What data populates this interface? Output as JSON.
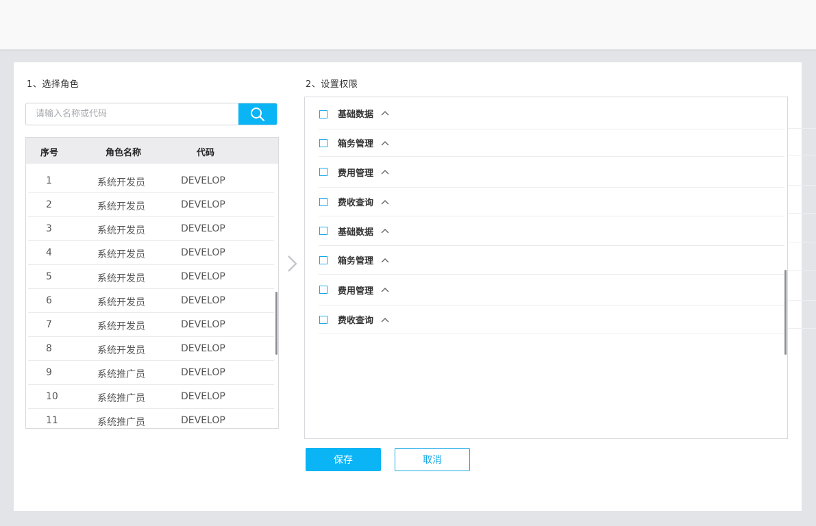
{
  "left": {
    "title": "1、选择角色",
    "search_placeholder": "请输入名称或代码",
    "table": {
      "headers": [
        "序号",
        "角色名称",
        "代码"
      ],
      "rows": [
        {
          "no": "1",
          "name": "系统开发员",
          "code": "DEVELOP"
        },
        {
          "no": "2",
          "name": "系统开发员",
          "code": "DEVELOP"
        },
        {
          "no": "3",
          "name": "系统开发员",
          "code": "DEVELOP"
        },
        {
          "no": "4",
          "name": "系统开发员",
          "code": "DEVELOP"
        },
        {
          "no": "5",
          "name": "系统开发员",
          "code": "DEVELOP"
        },
        {
          "no": "6",
          "name": "系统开发员",
          "code": "DEVELOP"
        },
        {
          "no": "7",
          "name": "系统开发员",
          "code": "DEVELOP"
        },
        {
          "no": "8",
          "name": "系统开发员",
          "code": "DEVELOP"
        },
        {
          "no": "9",
          "name": "系统推广员",
          "code": "DEVELOP"
        },
        {
          "no": "10",
          "name": "系统推广员",
          "code": "DEVELOP"
        },
        {
          "no": "11",
          "name": "系统推广员",
          "code": "DEVELOP"
        }
      ]
    }
  },
  "right": {
    "title": "2、设置权限",
    "permissions": [
      {
        "label": "基础数据",
        "checked": false
      },
      {
        "label": "箱务管理",
        "checked": false
      },
      {
        "label": "费用管理",
        "checked": false
      },
      {
        "label": "费收查询",
        "checked": false
      },
      {
        "label": "基础数据",
        "checked": false
      },
      {
        "label": "箱务管理",
        "checked": false
      },
      {
        "label": "费用管理",
        "checked": false
      },
      {
        "label": "费收查询",
        "checked": false
      }
    ]
  },
  "actions": {
    "save_label": "保存",
    "cancel_label": "取消"
  },
  "icons": {
    "search": "search-icon",
    "move": "chevron-right-icon",
    "expand": "chevron-up-icon",
    "checkbox": "checkbox-icon"
  },
  "colors": {
    "accent": "#0ab4f5",
    "accent_border": "#18a8e6",
    "page_bg": "#e3e4e8"
  }
}
